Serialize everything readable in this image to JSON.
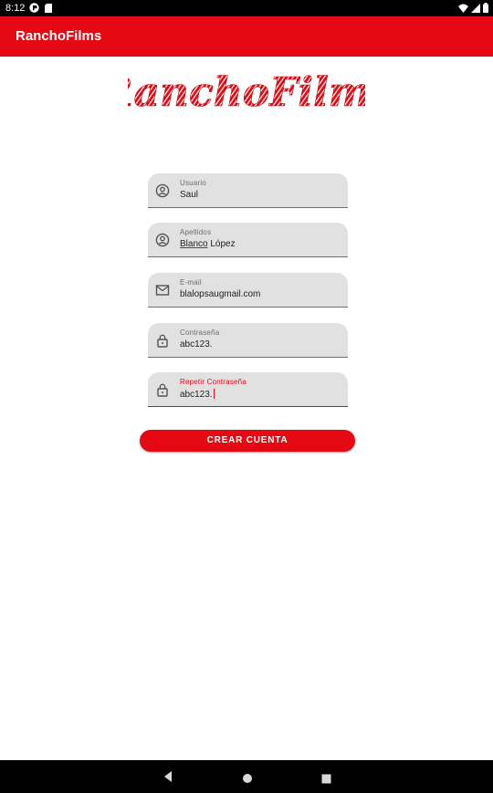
{
  "status_bar": {
    "time": "8:12",
    "icons_left": [
      "notification-app-icon",
      "sim-card-icon"
    ],
    "icons_right": [
      "wifi-icon",
      "signal-icon",
      "battery-icon"
    ]
  },
  "app_bar": {
    "title": "RanchoFilms"
  },
  "logo": {
    "text": "RanchoFilms",
    "color": "#e50914"
  },
  "form": {
    "fields": [
      {
        "label": "Usuario",
        "value": "Saul",
        "icon": "account-circle-icon"
      },
      {
        "label": "Apellidos",
        "value_underlined": "Blanco",
        "value_rest": " López",
        "icon": "account-circle-icon"
      },
      {
        "label": "E-mail",
        "value": "blalopsaugmail.com",
        "icon": "mail-icon"
      },
      {
        "label": "Contraseña",
        "value": "abc123.",
        "icon": "lock-icon"
      },
      {
        "label": "Repetir Contraseña",
        "value": "abc123.",
        "icon": "lock-icon",
        "focused": true
      }
    ],
    "submit_label": "CREAR CUENTA"
  },
  "nav_bar": {
    "buttons": [
      "back-icon",
      "home-icon",
      "recents-icon"
    ]
  },
  "colors": {
    "accent": "#e50914",
    "field_bg": "#e1e1e1"
  }
}
